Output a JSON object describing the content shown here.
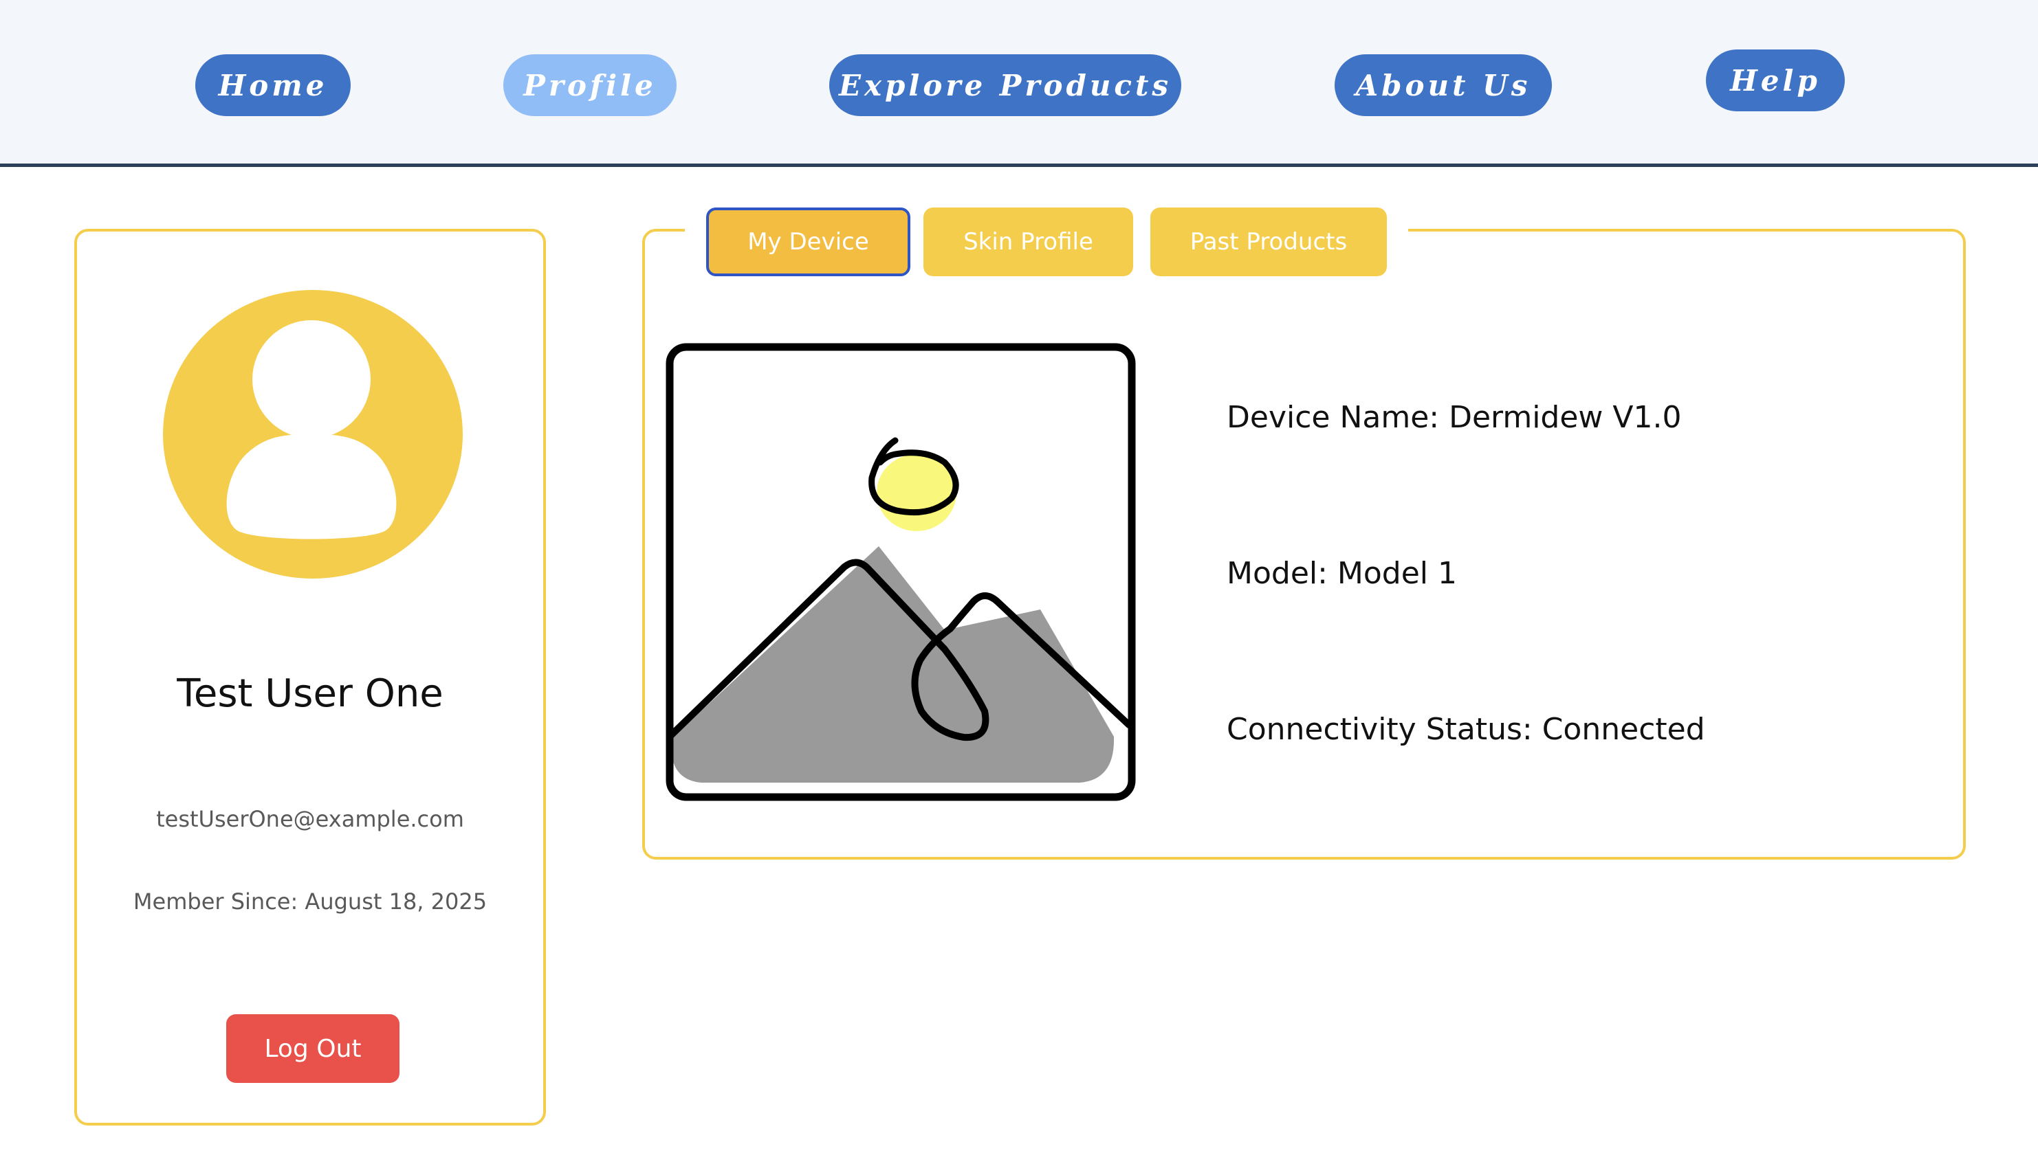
{
  "nav": {
    "items": [
      {
        "label": "Home"
      },
      {
        "label": "Profile"
      },
      {
        "label": "Explore Products"
      },
      {
        "label": "About Us"
      },
      {
        "label": "Help"
      }
    ],
    "active": "Profile"
  },
  "profile": {
    "name": "Test User One",
    "email": "testUserOne@example.com",
    "member_since": "Member Since: August 18, 2025",
    "logout_label": "Log Out",
    "avatar_icon": "user-avatar-icon"
  },
  "tabs": [
    {
      "label": "My Device"
    },
    {
      "label": "Skin Profile"
    },
    {
      "label": "Past Products"
    }
  ],
  "active_tab": "My Device",
  "device": {
    "image_icon": "image-placeholder-icon",
    "name": "Device Name: Dermidew V1.0",
    "model": "Model: Model 1",
    "status": "Connectivity Status: Connected"
  },
  "colors": {
    "nav_button": "#3f73c5",
    "nav_button_active": "#91bdf6",
    "accent_yellow": "#f5cd4c",
    "active_tab": "#f2bd40",
    "logout_red": "#e8524a"
  }
}
